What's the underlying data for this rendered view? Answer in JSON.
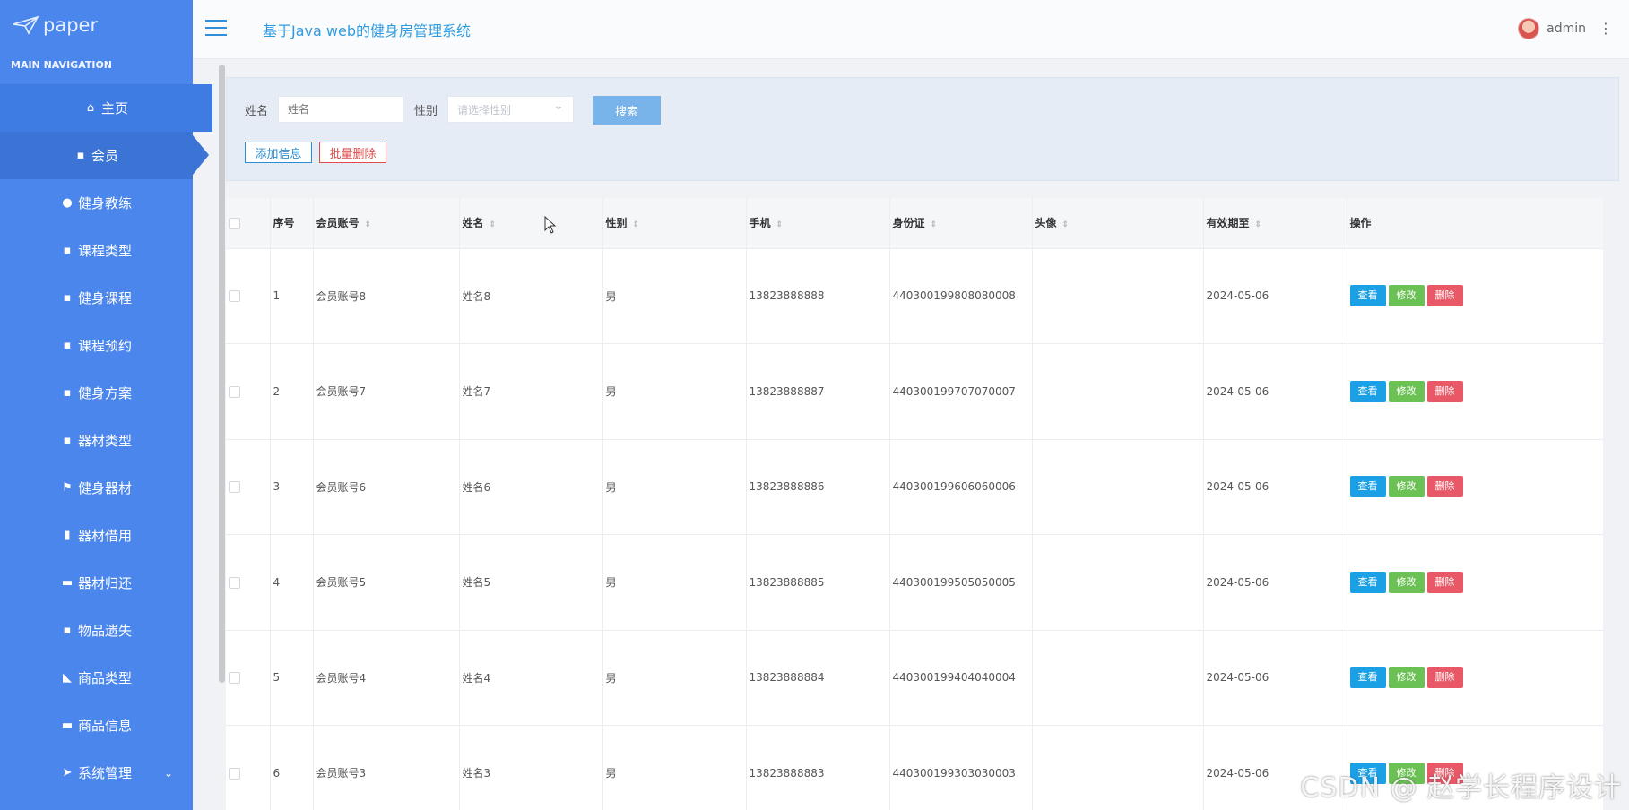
{
  "sidebar": {
    "logo_text": "paper",
    "nav_header": "MAIN NAVIGATION",
    "items": [
      {
        "label": "主页",
        "icon": "⌂"
      },
      {
        "label": "会员",
        "icon": "▪"
      },
      {
        "label": "健身教练",
        "icon": "●"
      },
      {
        "label": "课程类型",
        "icon": "▪"
      },
      {
        "label": "健身课程",
        "icon": "▪"
      },
      {
        "label": "课程预约",
        "icon": "▪"
      },
      {
        "label": "健身方案",
        "icon": "▪"
      },
      {
        "label": "器材类型",
        "icon": "▪"
      },
      {
        "label": "健身器材",
        "icon": "⚑"
      },
      {
        "label": "器材借用",
        "icon": "▮"
      },
      {
        "label": "器材归还",
        "icon": "▬"
      },
      {
        "label": "物品遗失",
        "icon": "▪"
      },
      {
        "label": "商品类型",
        "icon": "◣"
      },
      {
        "label": "商品信息",
        "icon": "▬"
      },
      {
        "label": "系统管理",
        "icon": "➤",
        "chevron": "⌄"
      }
    ]
  },
  "header": {
    "app_title": "基于Java web的健身房管理系统",
    "user_name": "admin",
    "menu_glyph": "⋮"
  },
  "search": {
    "name_label": "姓名",
    "name_placeholder": "姓名",
    "gender_label": "性别",
    "gender_placeholder": "请选择性别",
    "search_button": "搜索",
    "add_button": "添加信息",
    "batch_delete_button": "批量删除"
  },
  "table": {
    "columns": [
      "序号",
      "会员账号",
      "姓名",
      "性别",
      "手机",
      "身份证",
      "头像",
      "有效期至",
      "操作"
    ],
    "sort_glyph": "⇕",
    "actions": {
      "view": "查看",
      "edit": "修改",
      "delete": "删除"
    },
    "rows": [
      {
        "no": "1",
        "account": "会员账号8",
        "name": "姓名8",
        "gender": "男",
        "phone": "13823888888",
        "id_card": "440300199808080008",
        "avatar": "",
        "expire": "2024-05-06"
      },
      {
        "no": "2",
        "account": "会员账号7",
        "name": "姓名7",
        "gender": "男",
        "phone": "13823888887",
        "id_card": "440300199707070007",
        "avatar": "",
        "expire": "2024-05-06"
      },
      {
        "no": "3",
        "account": "会员账号6",
        "name": "姓名6",
        "gender": "男",
        "phone": "13823888886",
        "id_card": "440300199606060006",
        "avatar": "",
        "expire": "2024-05-06"
      },
      {
        "no": "4",
        "account": "会员账号5",
        "name": "姓名5",
        "gender": "男",
        "phone": "13823888885",
        "id_card": "440300199505050005",
        "avatar": "",
        "expire": "2024-05-06"
      },
      {
        "no": "5",
        "account": "会员账号4",
        "name": "姓名4",
        "gender": "男",
        "phone": "13823888884",
        "id_card": "440300199404040004",
        "avatar": "",
        "expire": "2024-05-06"
      },
      {
        "no": "6",
        "account": "会员账号3",
        "name": "姓名3",
        "gender": "男",
        "phone": "13823888883",
        "id_card": "440300199303030003",
        "avatar": "",
        "expire": "2024-05-06"
      }
    ]
  },
  "watermark": "CSDN @ 赵学长程序设计",
  "colors": {
    "sidebar_bg": "#4b86ec",
    "title": "#2e9be0",
    "view_button": "#1ba0e6",
    "edit_button": "#6cc155",
    "delete_button": "#e85867"
  }
}
